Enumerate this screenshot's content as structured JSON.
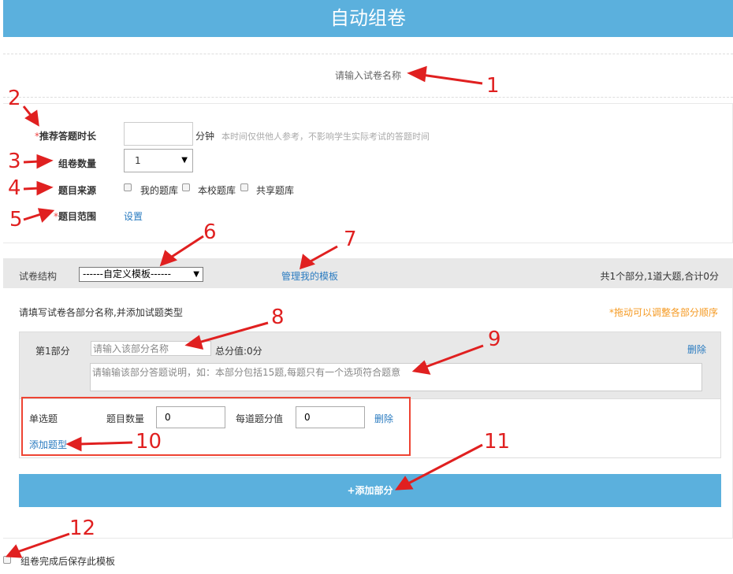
{
  "header": {
    "title": "自动组卷"
  },
  "paper_name": {
    "placeholder": "请输入试卷名称"
  },
  "settings": {
    "duration": {
      "required_mark": "*",
      "label": "推荐答题时长",
      "value": "",
      "unit": "分钟",
      "hint": "本时间仅供他人参考，不影响学生实际考试的答题时间"
    },
    "count": {
      "label": "组卷数量",
      "value": "1"
    },
    "source": {
      "label": "题目来源",
      "options": [
        "我的题库",
        "本校题库",
        "共享题库"
      ]
    },
    "scope": {
      "required_mark": "*",
      "label": "题目范围",
      "link": "设置"
    }
  },
  "structure": {
    "label": "试卷结构",
    "template_value": "------自定义模板------",
    "manage_link": "管理我的模板",
    "summary": "共1个部分,1道大题,合计0分"
  },
  "parts": {
    "instruction": "请填写试卷各部分名称,并添加试题类型",
    "drag_hint": "*拖动可以调整各部分顺序",
    "part1": {
      "label": "第1部分",
      "name_placeholder": "请输入该部分名称",
      "total": "总分值:0分",
      "delete": "删除",
      "desc_placeholder": "请输输该部分答题说明，如：本部分包括15题,每题只有一个选项符合题意"
    },
    "question_type": {
      "type": "单选题",
      "count_label": "题目数量",
      "count_value": "0",
      "score_label": "每道题分值",
      "score_value": "0",
      "delete": "删除",
      "add_type": "添加题型"
    },
    "add_part": "+添加部分"
  },
  "save_template": {
    "label": "组卷完成后保存此模板"
  },
  "annotations": [
    "1",
    "2",
    "3",
    "4",
    "5",
    "6",
    "7",
    "8",
    "9",
    "10",
    "11",
    "12"
  ],
  "colors": {
    "accent": "#5bb0dd",
    "link": "#2a7bc0",
    "warning": "#f59a23",
    "annotation": "#e02020"
  }
}
